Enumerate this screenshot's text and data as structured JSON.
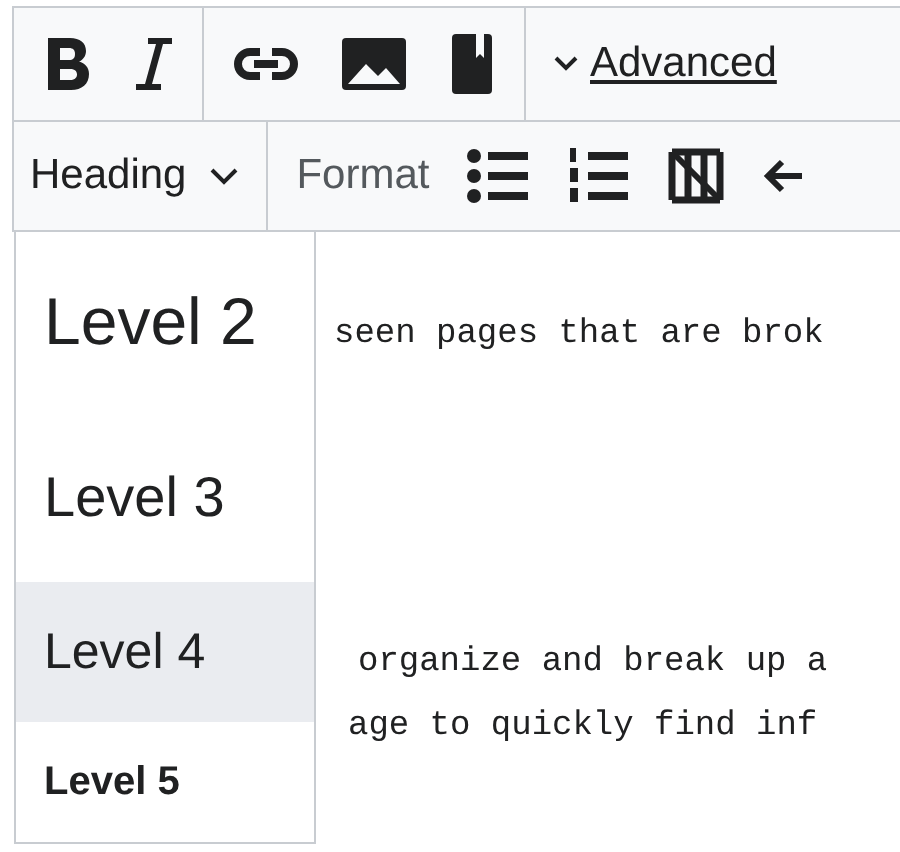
{
  "toolbar_main": {
    "advanced_label": "Advanced"
  },
  "toolbar_secondary": {
    "heading_label": "Heading",
    "format_label": "Format"
  },
  "editor": {
    "lines": [
      {
        "text": "seen pages that are brok"
      },
      {
        "text": "organize and break up a"
      },
      {
        "text": "age to quickly find inf"
      }
    ]
  },
  "heading_menu": {
    "items": [
      {
        "label": "Level 2",
        "kind": "h2",
        "selected": false
      },
      {
        "label": "Level 3",
        "kind": "h3",
        "selected": false
      },
      {
        "label": "Level 4",
        "kind": "h4",
        "selected": true
      },
      {
        "label": "Level 5",
        "kind": "h5",
        "selected": false
      }
    ]
  }
}
